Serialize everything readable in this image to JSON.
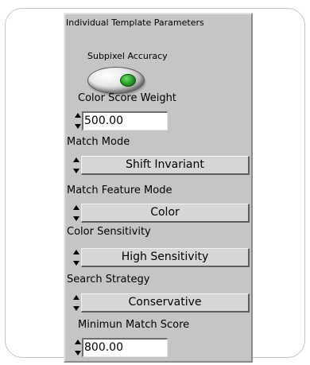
{
  "panel": {
    "title": "Individual Template Parameters"
  },
  "subpixel": {
    "label": "Subpixel Accuracy",
    "state": "on",
    "led_color": "#1f9a1f"
  },
  "color_score_weight": {
    "label": "Color Score Weight",
    "value": "500.00"
  },
  "match_mode": {
    "label": "Match Mode",
    "value": "Shift Invariant"
  },
  "match_feature_mode": {
    "label": "Match Feature Mode",
    "value": "Color"
  },
  "color_sensitivity": {
    "label": "Color Sensitivity",
    "value": "High Sensitivity"
  },
  "search_strategy": {
    "label": "Search Strategy",
    "value": "Conservative"
  },
  "minimum_match_score": {
    "label": "Minimun Match Score",
    "value": "800.00"
  }
}
